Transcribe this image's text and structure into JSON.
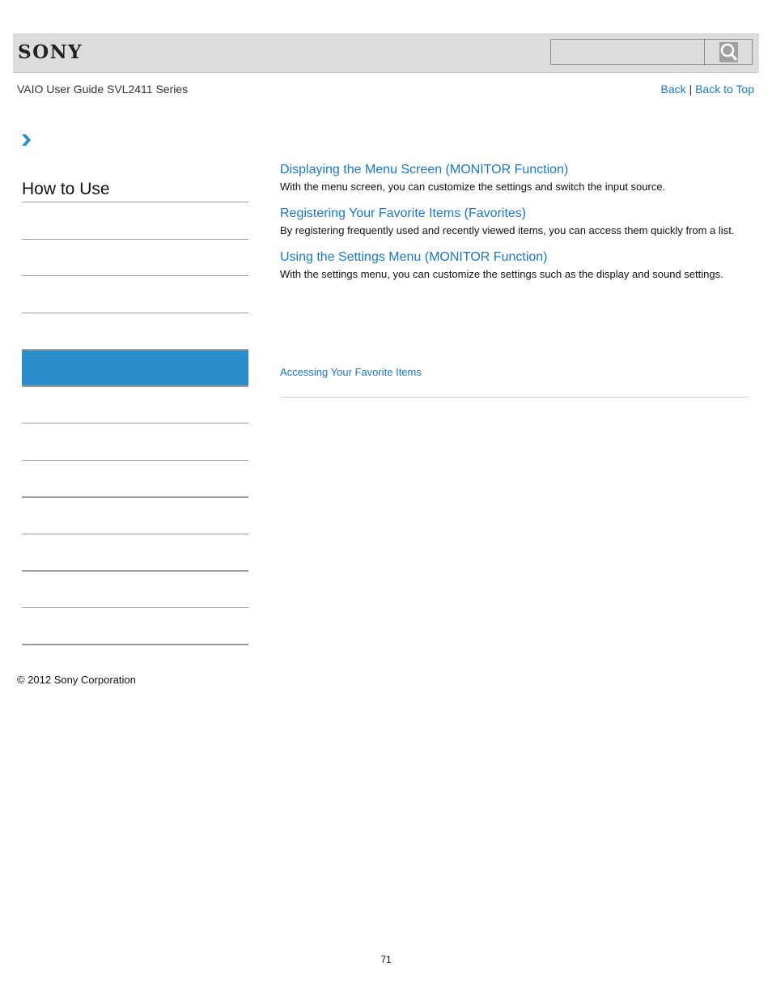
{
  "header": {
    "logo": "SONY",
    "search": {
      "placeholder": "",
      "value": "",
      "button_icon": "search-icon"
    }
  },
  "guide_title": "VAIO User Guide SVL2411 Series",
  "nav_links": {
    "back": "Back",
    "separator": "|",
    "back_to_top": "Back to Top"
  },
  "breadcrumb": {
    "icon": "chevron-right-icon"
  },
  "sidebar": {
    "title": "How to Use",
    "items": [
      {
        "label": "",
        "active": false
      },
      {
        "label": "",
        "active": false
      },
      {
        "label": "",
        "active": false
      },
      {
        "label": "",
        "active": false
      },
      {
        "label": "",
        "active": true
      },
      {
        "label": "",
        "active": false
      },
      {
        "label": "",
        "active": false
      },
      {
        "label": "",
        "active": false
      },
      {
        "label": "",
        "active": false
      },
      {
        "label": "",
        "active": false
      },
      {
        "label": "",
        "active": false
      },
      {
        "label": "",
        "active": false
      }
    ],
    "active_color": "#2a8ecd"
  },
  "main": {
    "topics": [
      {
        "title": "Displaying the Menu Screen (MONITOR Function)",
        "description": "With the menu screen, you can customize the settings and switch the input source."
      },
      {
        "title": "Registering Your Favorite Items (Favorites)",
        "description": "By registering frequently used and recently viewed items, you can access them quickly from a list."
      },
      {
        "title": "Using the Settings Menu (MONITOR Function)",
        "description": "With the settings menu, you can customize the settings such as the display and sound settings."
      }
    ],
    "related_link": "Accessing Your Favorite Items"
  },
  "footer": {
    "copyright": "© 2012 Sony Corporation",
    "page_number": "71"
  },
  "colors": {
    "link": "#1a77c7",
    "header_bg": "#dcdcdc"
  }
}
